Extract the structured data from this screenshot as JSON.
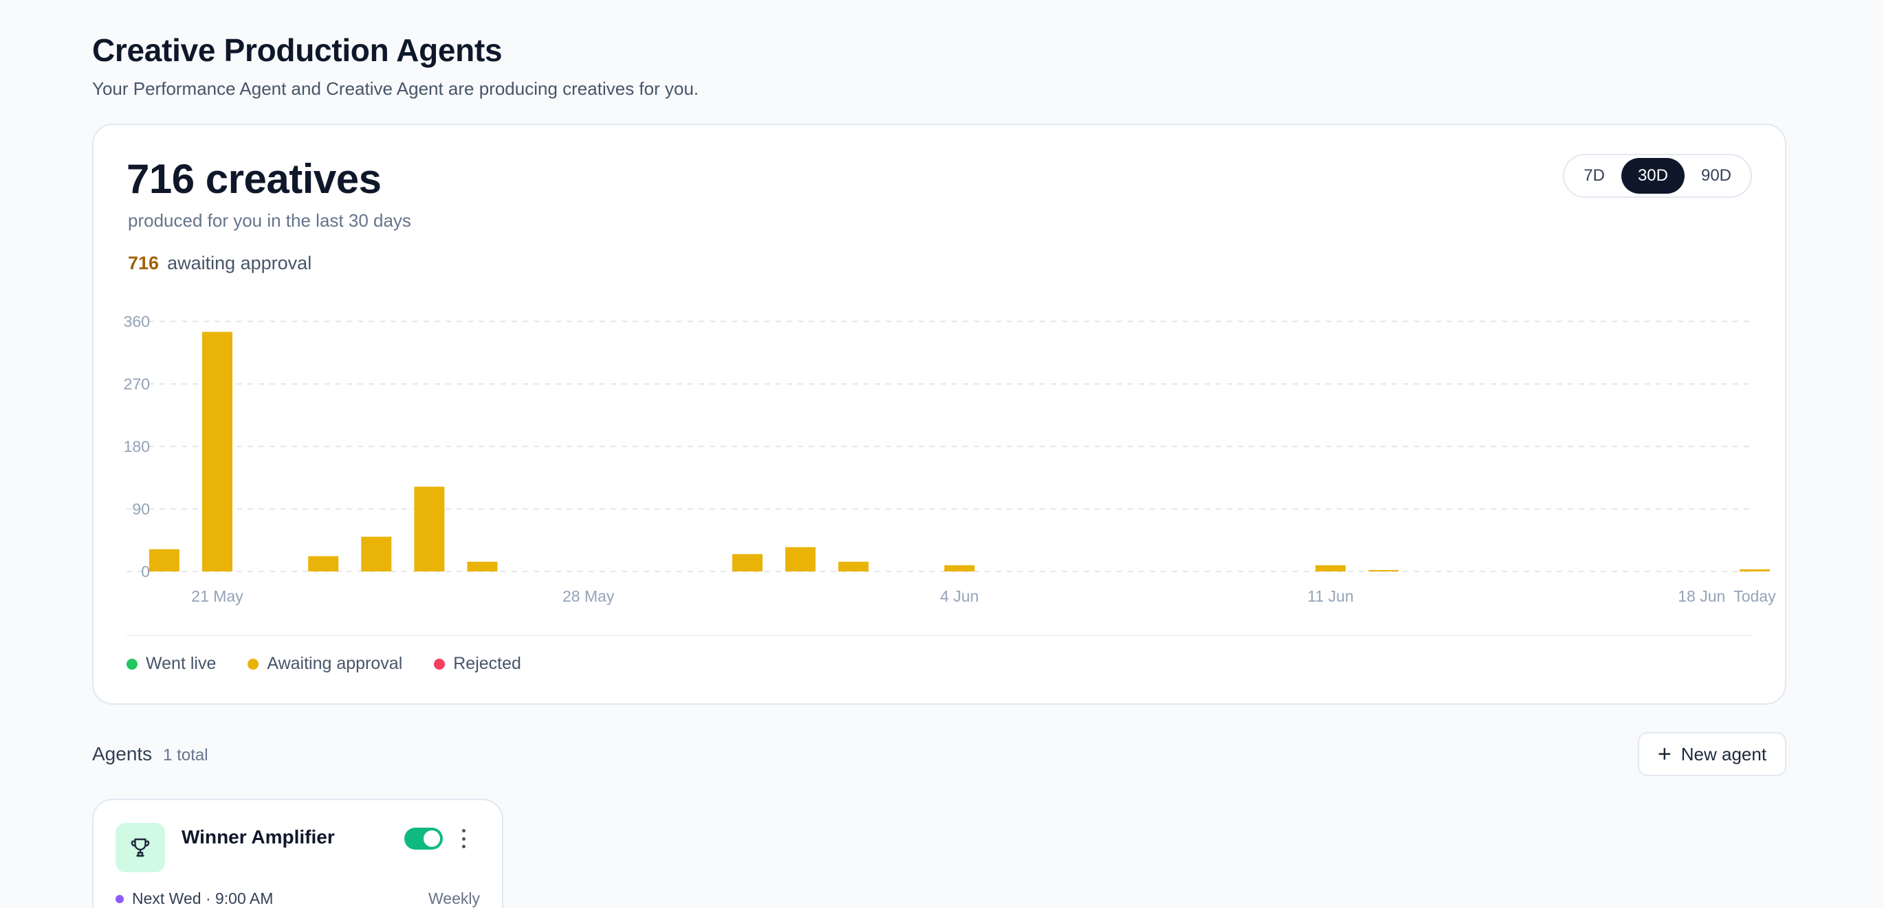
{
  "header": {
    "title": "Creative Production Agents",
    "subtitle": "Your Performance Agent and Creative Agent are producing creatives for you."
  },
  "summary": {
    "count_label": "716 creatives",
    "caption": "produced for you in the last 30 days",
    "awaiting_count": "716",
    "awaiting_label": "awaiting approval"
  },
  "range_toggle": {
    "options": [
      "7D",
      "30D",
      "90D"
    ],
    "selected": "30D"
  },
  "colors": {
    "went_live": "#22c55e",
    "awaiting": "#eab308",
    "rejected": "#f43f5e",
    "accent_dark": "#0f172a",
    "toggle_on": "#10b981"
  },
  "chart_data": {
    "type": "bar",
    "ylim": [
      0,
      360
    ],
    "yticks": [
      0,
      90,
      180,
      270,
      360
    ],
    "x_tick_labels": [
      {
        "day": 0,
        "label": "21 May"
      },
      {
        "day": 7,
        "label": "28 May"
      },
      {
        "day": 14,
        "label": "4 Jun"
      },
      {
        "day": 21,
        "label": "11 Jun"
      },
      {
        "day": 28,
        "label": "18 Jun"
      },
      {
        "day": 29,
        "label": "Today"
      }
    ],
    "series": [
      {
        "name": "Awaiting approval",
        "day": [
          -1,
          0,
          2,
          3,
          4,
          5,
          10,
          11,
          12,
          14,
          21,
          22,
          29
        ],
        "values": [
          32,
          345,
          22,
          50,
          122,
          14,
          25,
          35,
          14,
          9,
          9,
          2,
          3
        ]
      }
    ],
    "legend": [
      "Went live",
      "Awaiting approval",
      "Rejected"
    ]
  },
  "agents": {
    "title": "Agents",
    "count_label": "1 total",
    "new_button_label": "New agent",
    "items": [
      {
        "name": "Winner Amplifier",
        "icon": "trophy-icon",
        "enabled": true,
        "schedule": "Next Wed · 9:00 AM",
        "frequency": "Weekly"
      }
    ]
  }
}
